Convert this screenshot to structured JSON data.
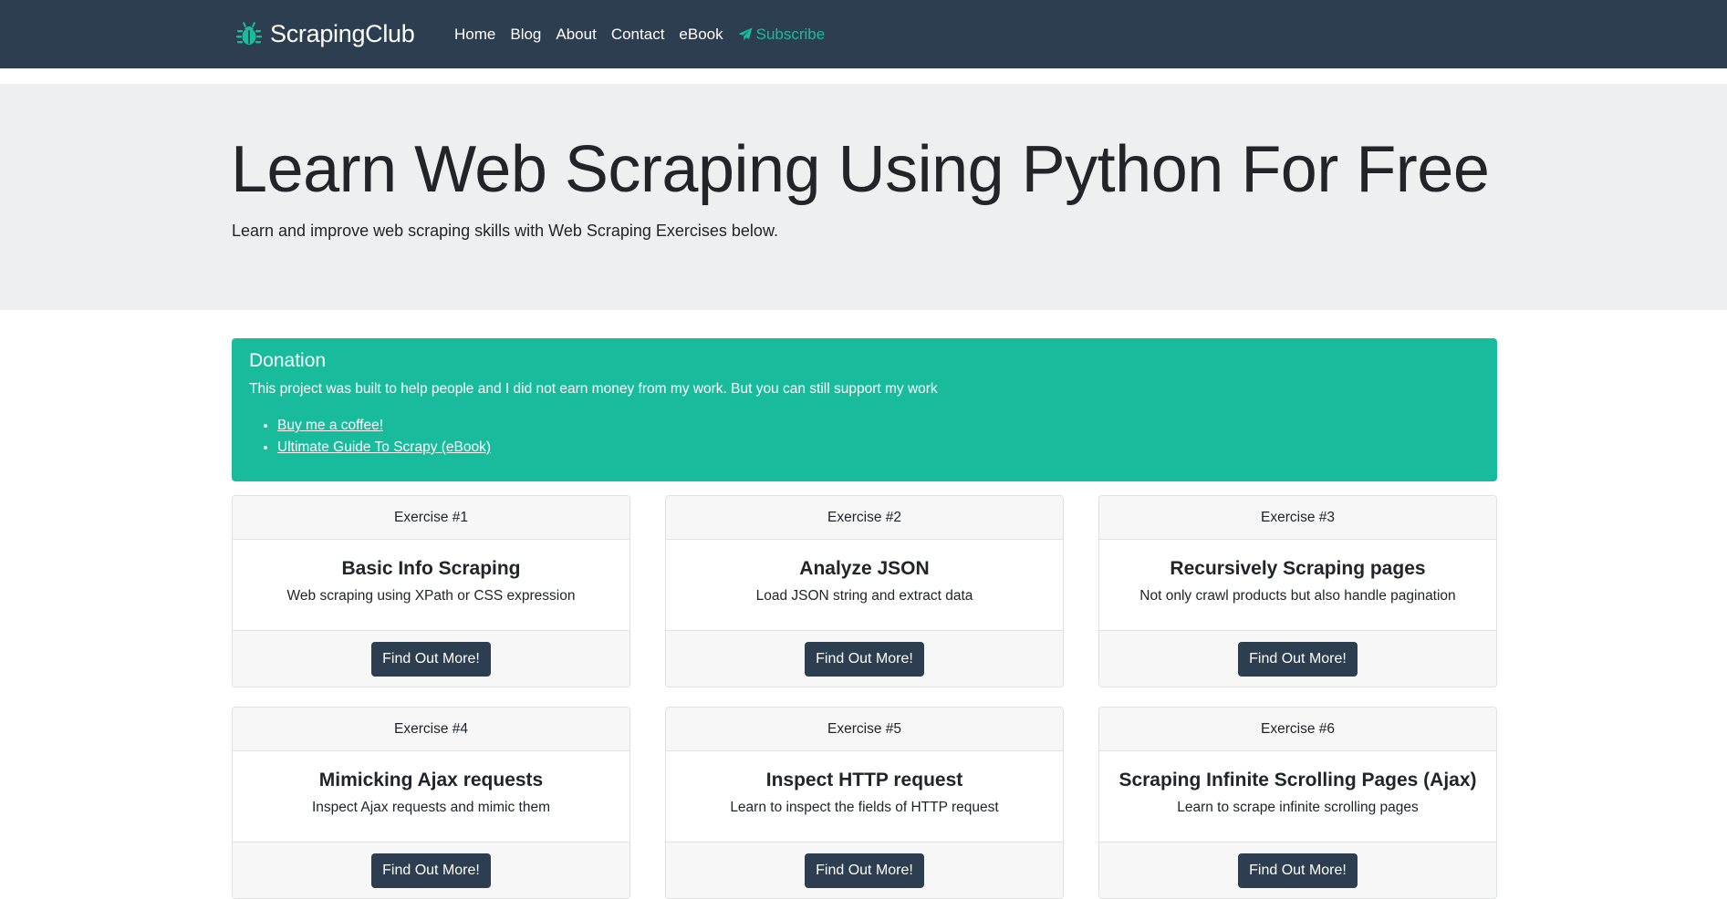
{
  "navbar": {
    "brand": "ScrapingClub",
    "links": [
      "Home",
      "Blog",
      "About",
      "Contact",
      "eBook"
    ],
    "subscribe": "Subscribe",
    "colors": {
      "background": "#2c3e50",
      "accent": "#1abc9c"
    }
  },
  "hero": {
    "title": "Learn Web Scraping Using Python For Free",
    "lead": "Learn and improve web scraping skills with Web Scraping Exercises below."
  },
  "donation": {
    "heading": "Donation",
    "text": "This project was built to help people and I did not earn money from my work. But you can still support my work",
    "links": [
      "Buy me a coffee!",
      "Ultimate Guide To Scrapy (eBook)"
    ],
    "color": "#18bc9c"
  },
  "exercises": [
    {
      "header": "Exercise #1",
      "title": "Basic Info Scraping",
      "text": "Web scraping using XPath or CSS expression",
      "button": "Find Out More!"
    },
    {
      "header": "Exercise #2",
      "title": "Analyze JSON",
      "text": "Load JSON string and extract data",
      "button": "Find Out More!"
    },
    {
      "header": "Exercise #3",
      "title": "Recursively Scraping pages",
      "text": "Not only crawl products but also handle pagination",
      "button": "Find Out More!"
    },
    {
      "header": "Exercise #4",
      "title": "Mimicking Ajax requests",
      "text": "Inspect Ajax requests and mimic them",
      "button": "Find Out More!"
    },
    {
      "header": "Exercise #5",
      "title": "Inspect HTTP request",
      "text": "Learn to inspect the fields of HTTP request",
      "button": "Find Out More!"
    },
    {
      "header": "Exercise #6",
      "title": "Scraping Infinite Scrolling Pages (Ajax)",
      "text": "Learn to scrape infinite scrolling pages",
      "button": "Find Out More!"
    }
  ]
}
